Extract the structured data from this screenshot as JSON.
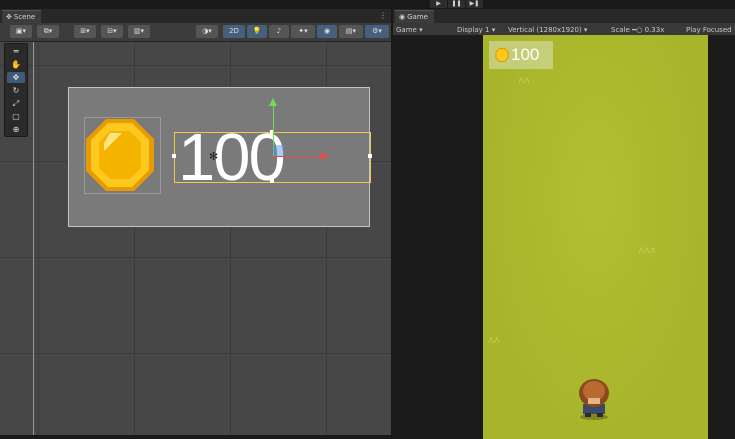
{
  "play_controls": {
    "play": "▶",
    "pause": "❚❚",
    "step": "▶❚"
  },
  "scene": {
    "tab_label": "Scene",
    "canvas": {
      "score_text": "100"
    }
  },
  "game": {
    "tab_label": "Game",
    "toolbar": {
      "mode": "Game",
      "display": "Display 1",
      "resolution": "Vertical (1280x1920)",
      "scale_label": "Scale",
      "scale_value": "0.33x",
      "play_focused": "Play Focused"
    },
    "hud": {
      "score": "100"
    }
  },
  "colors": {
    "grass": "#a8b42a",
    "coin": "#f5b800",
    "selection": "#f2c94c"
  }
}
